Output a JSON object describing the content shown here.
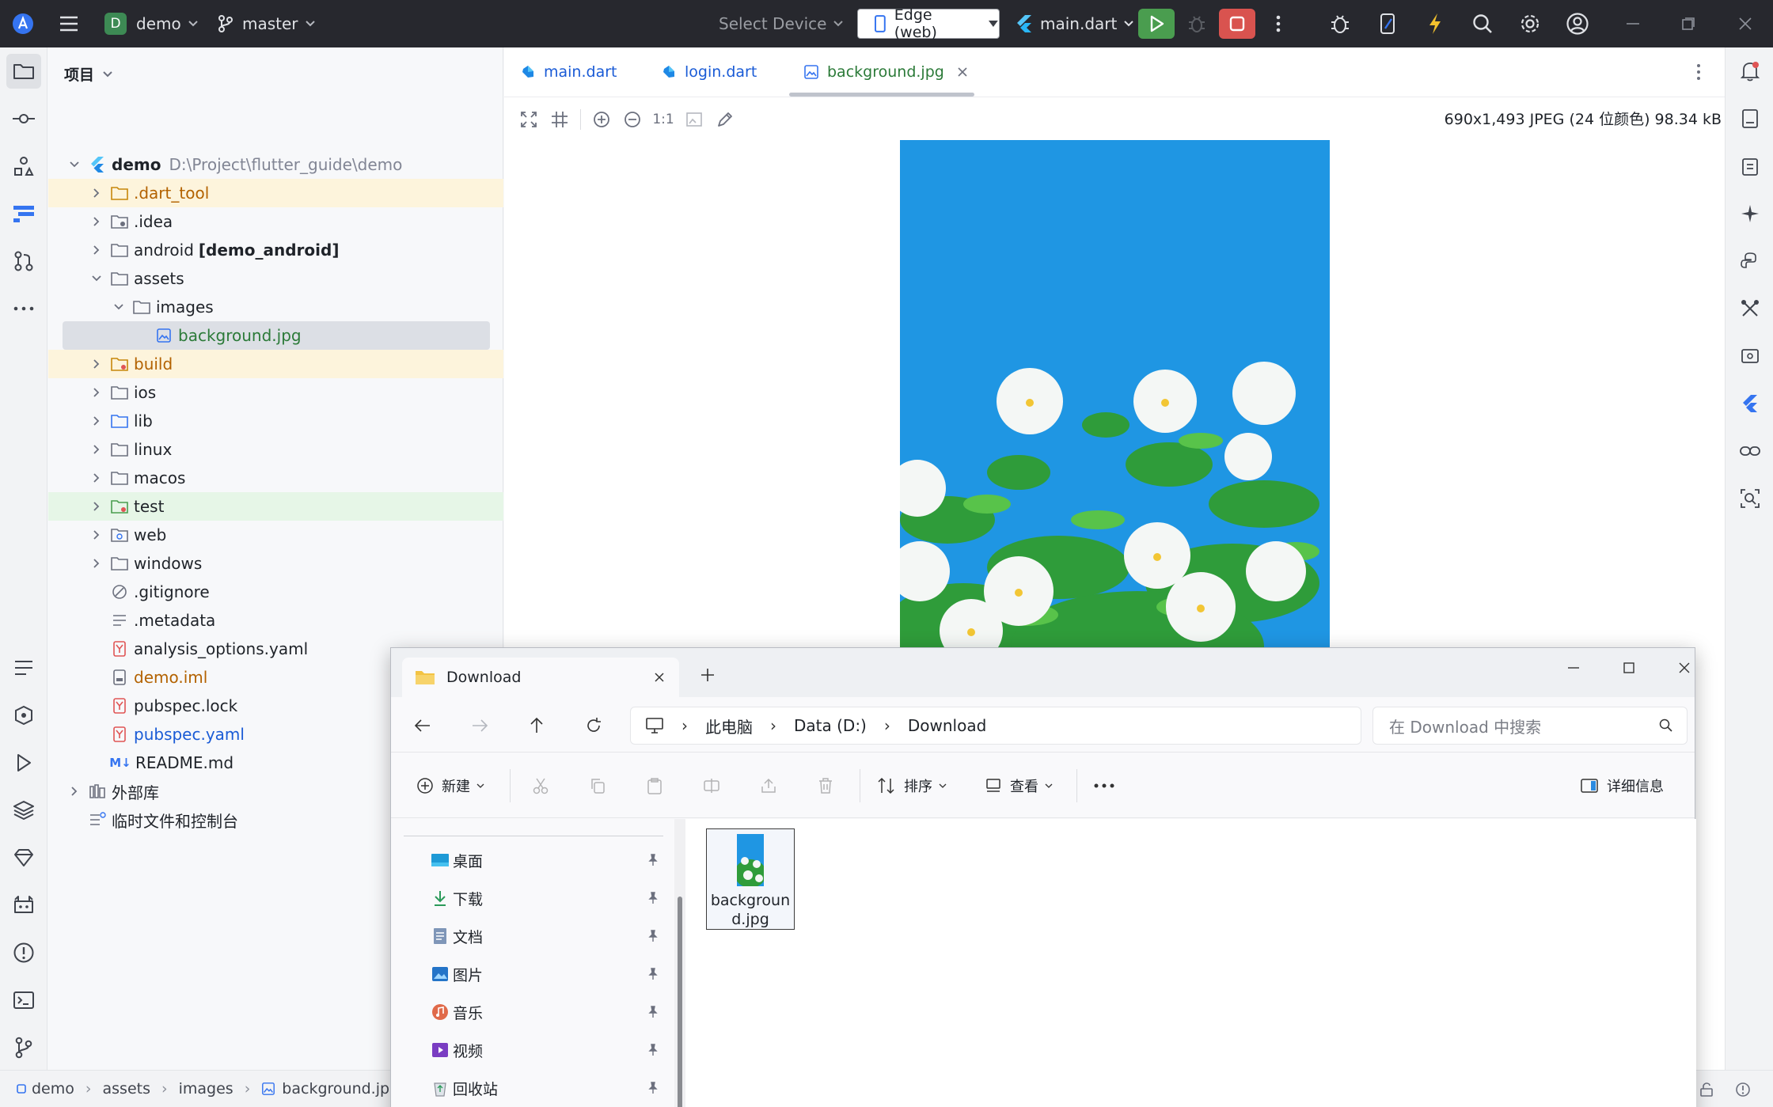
{
  "titlebar": {
    "project_initial": "D",
    "project_name": "demo",
    "branch": "master",
    "select_device": "Select Device",
    "device": "Edge (web)",
    "run_config": "main.dart"
  },
  "project_panel": {
    "title": "项目",
    "root_name": "demo",
    "root_path": "D:\\Project\\flutter_guide\\demo",
    "items": [
      {
        "label": ".dart_tool"
      },
      {
        "label": ".idea"
      },
      {
        "label": "android",
        "suffix": "[demo_android]"
      },
      {
        "label": "assets"
      },
      {
        "label": "images"
      },
      {
        "label": "background.jpg"
      },
      {
        "label": "build"
      },
      {
        "label": "ios"
      },
      {
        "label": "lib"
      },
      {
        "label": "linux"
      },
      {
        "label": "macos"
      },
      {
        "label": "test"
      },
      {
        "label": "web"
      },
      {
        "label": "windows"
      },
      {
        "label": ".gitignore"
      },
      {
        "label": ".metadata"
      },
      {
        "label": "analysis_options.yaml"
      },
      {
        "label": "demo.iml"
      },
      {
        "label": "pubspec.lock"
      },
      {
        "label": "pubspec.yaml"
      },
      {
        "label": "README.md"
      },
      {
        "label": "外部库"
      },
      {
        "label": "临时文件和控制台"
      }
    ]
  },
  "editor": {
    "tabs": [
      {
        "label": "main.dart"
      },
      {
        "label": "login.dart"
      },
      {
        "label": "background.jpg"
      }
    ],
    "zoom_actual": "1:1",
    "image_info": "690x1,493 JPEG (24 位颜色) 98.34 kB"
  },
  "statusbar": {
    "crumbs": [
      "demo",
      "assets",
      "images",
      "background.jpg"
    ]
  },
  "explorer": {
    "tab_title": "Download",
    "address": [
      "此电脑",
      "Data (D:)",
      "Download"
    ],
    "search_placeholder": "在 Download 中搜索",
    "commands": {
      "new": "新建",
      "sort": "排序",
      "view": "查看",
      "details": "详细信息"
    },
    "nav_items": [
      {
        "label": "桌面"
      },
      {
        "label": "下载"
      },
      {
        "label": "文档"
      },
      {
        "label": "图片"
      },
      {
        "label": "音乐"
      },
      {
        "label": "视频"
      },
      {
        "label": "回收站"
      }
    ],
    "files": [
      {
        "name": "background.jpg"
      }
    ]
  },
  "colors": {
    "titlebar_bg": "#27282e",
    "run_green": "#4a9d4f",
    "stop_red": "#d9534f",
    "link_blue": "#1a5bd6",
    "excluded_orange": "#b36200",
    "image_sky": "#1f96e3"
  },
  "icons": [
    "app-logo-icon",
    "hamburger-menu-icon",
    "branch-icon",
    "phone-icon",
    "flutter-icon",
    "play-icon",
    "bug-icon",
    "stop-icon",
    "search-icon",
    "gear-icon",
    "account-icon",
    "folder-icon",
    "pin-icon"
  ]
}
